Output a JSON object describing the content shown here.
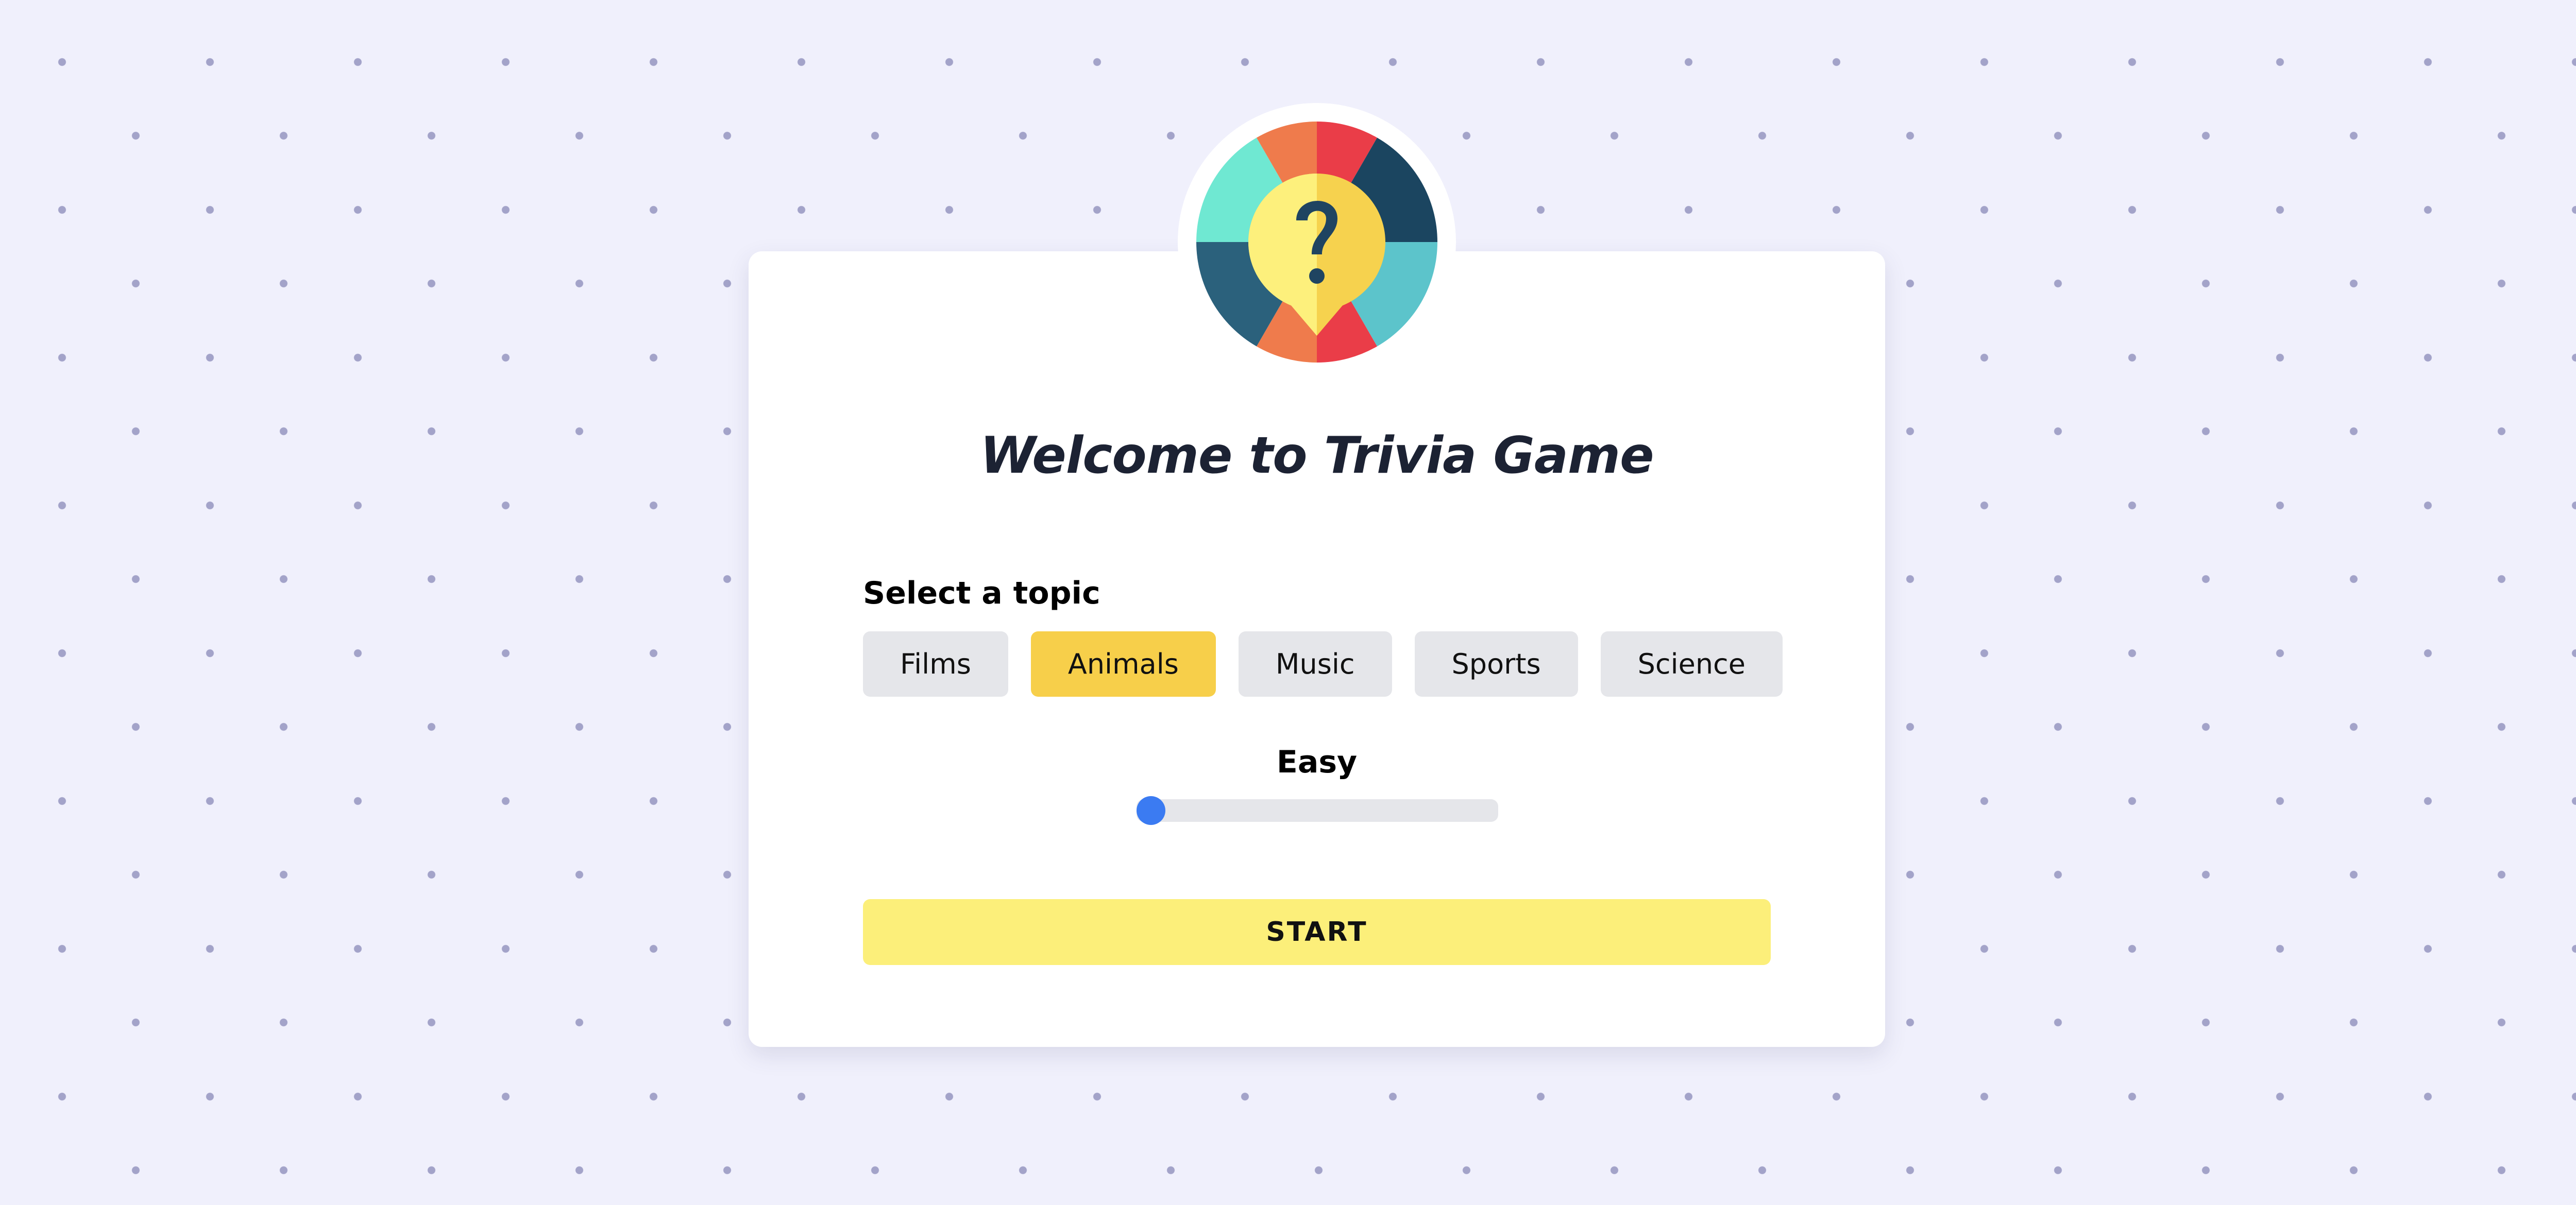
{
  "app": {
    "logo_icon": "trivia-wheel-icon",
    "title": "Welcome to Trivia Game"
  },
  "topics": {
    "label": "Select a topic",
    "items": [
      {
        "label": "Films",
        "selected": false
      },
      {
        "label": "Animals",
        "selected": true
      },
      {
        "label": "Music",
        "selected": false
      },
      {
        "label": "Sports",
        "selected": false
      },
      {
        "label": "Science",
        "selected": false
      }
    ]
  },
  "difficulty": {
    "label": "Easy",
    "value": 0
  },
  "start": {
    "label": "START"
  },
  "colors": {
    "background": "#f0f0fc",
    "dot": "#a3a3c9",
    "card": "#ffffff",
    "title": "#1c2233",
    "topic_default": "#e5e6ea",
    "topic_selected": "#f7cf4a",
    "slider_track": "#e5e6ea",
    "slider_thumb": "#3b7bf2",
    "start_button": "#fcef7a"
  }
}
